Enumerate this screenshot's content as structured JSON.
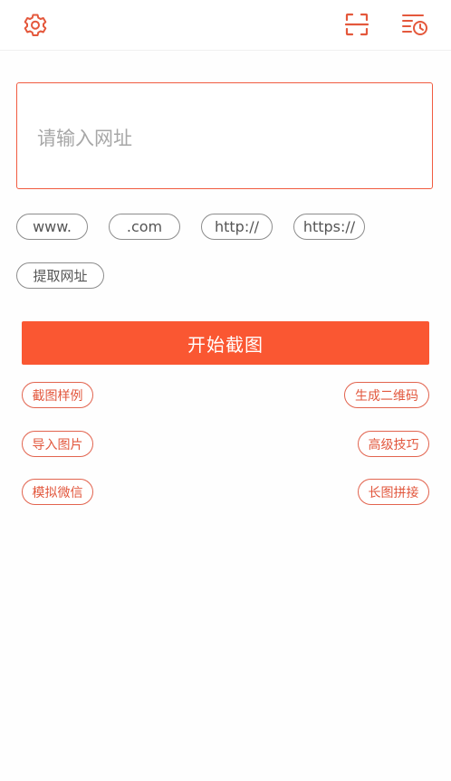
{
  "toolbar": {
    "settings_icon": "gear-icon",
    "scan_icon": "scan-frame-icon",
    "history_icon": "history-list-clock-icon",
    "accent_color": "#f15b40"
  },
  "url_input": {
    "placeholder": "请输入网址",
    "value": ""
  },
  "quick_chips": [
    {
      "label": "www."
    },
    {
      "label": ".com"
    },
    {
      "label": "http://"
    },
    {
      "label": "https://"
    }
  ],
  "extract_chip": {
    "label": "提取网址"
  },
  "primary_button": {
    "label": "开始截图",
    "color": "#fa5732"
  },
  "actions": [
    {
      "label": "截图样例"
    },
    {
      "label": "生成二维码"
    },
    {
      "label": "导入图片"
    },
    {
      "label": "高级技巧"
    },
    {
      "label": "模拟微信"
    },
    {
      "label": "长图拼接"
    }
  ]
}
